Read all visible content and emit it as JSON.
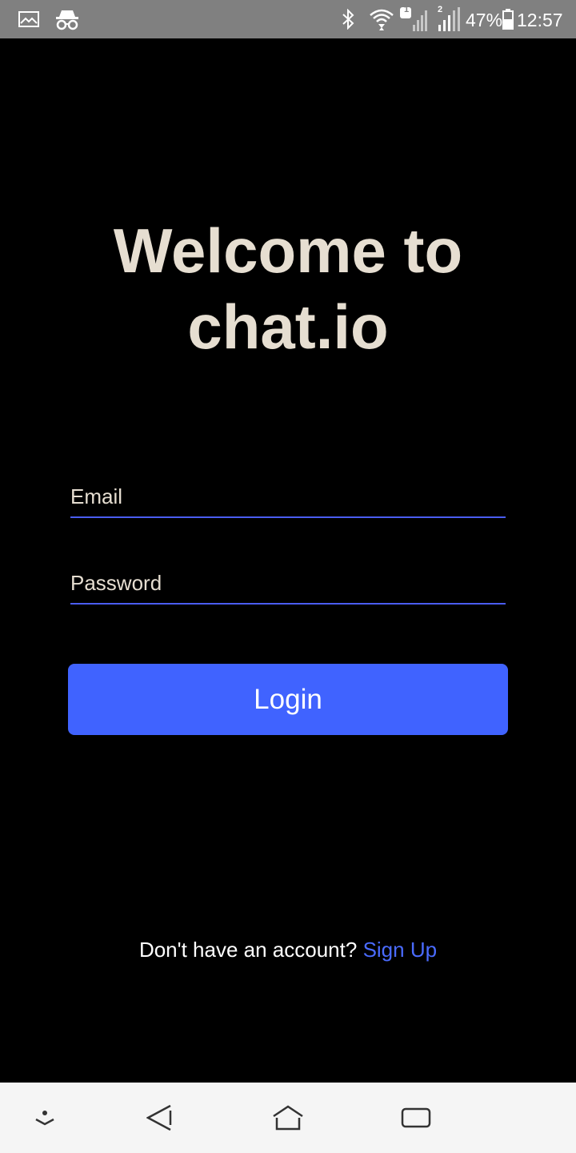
{
  "status_bar": {
    "icons_left": [
      "image-icon",
      "incognito-icon"
    ],
    "icons_right": [
      "bluetooth-icon",
      "wifi-icon",
      "signal-sim1-icon",
      "signal-sim2-icon",
      "battery-icon"
    ],
    "sim1_label": "1",
    "sim2_label": "2",
    "battery_percent": "47%",
    "time": "12:57"
  },
  "title": {
    "line1": "Welcome to",
    "line2": "chat.io"
  },
  "form": {
    "email_placeholder": "Email",
    "password_placeholder": "Password",
    "login_label": "Login"
  },
  "signup": {
    "prompt": "Don't have an account?",
    "link_label": "Sign Up"
  },
  "nav_bar": {
    "buttons": [
      "collapse-icon",
      "back-icon",
      "home-icon",
      "recents-icon"
    ]
  },
  "colors": {
    "background": "#000000",
    "title": "#e6ded1",
    "accent": "#4063ff",
    "link": "#4a6bff",
    "status_bar": "#808080",
    "nav_bar": "#f5f5f5"
  }
}
